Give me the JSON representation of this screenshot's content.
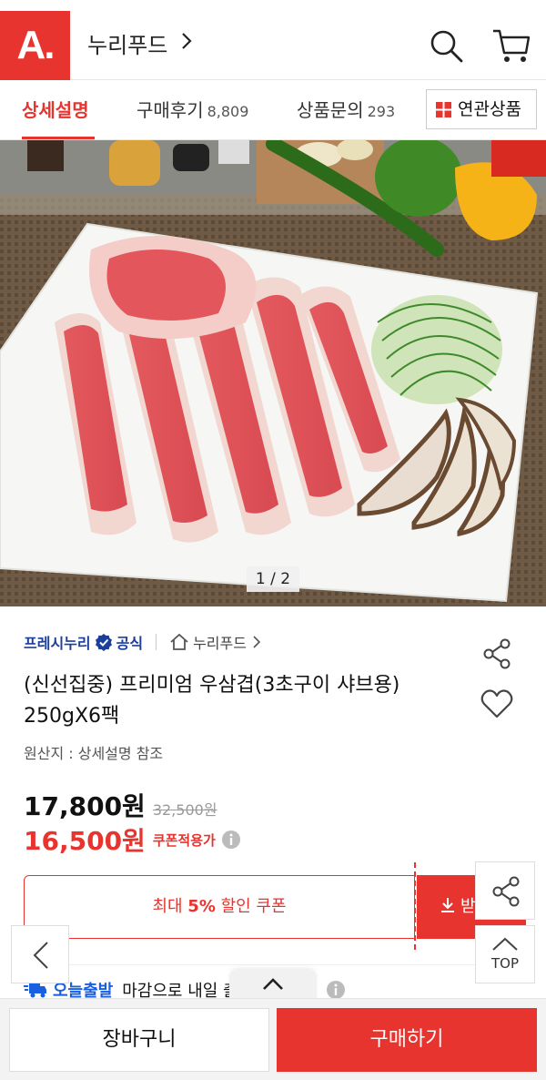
{
  "header": {
    "logo_text": "A.",
    "store_name": "누리푸드"
  },
  "tabs": [
    {
      "label": "상세설명",
      "count": ""
    },
    {
      "label": "구매후기",
      "count": "8,809"
    },
    {
      "label": "상품문의",
      "count": "293"
    }
  ],
  "related_button": {
    "label": "연관상품"
  },
  "hero": {
    "image_counter": "1 / 2",
    "description": "sliced beef brisket on white plate with shredded green onion and shiitake mushrooms"
  },
  "product": {
    "brand": "프레시누리",
    "official": "공식",
    "store_link": "누리푸드",
    "title": "(신선집중) 프리미엄 우삼겹(3초구이 샤브용) 250gX6팩",
    "origin": "원산지 : 상세설명 참조",
    "price": "17,800원",
    "original_price": "32,500원",
    "coupon_price": "16,500원",
    "coupon_price_label": "쿠폰적용가"
  },
  "coupon": {
    "prefix": "최대 ",
    "percent": "5%",
    "suffix": " 할인 쿠폰",
    "download_label": "받기"
  },
  "delivery": {
    "badge": "오늘출발",
    "text": "마감으로 내일 출발"
  },
  "floating": {
    "top_label": "TOP"
  },
  "bottom_bar": {
    "cart_label": "장바구니",
    "buy_label": "구매하기"
  },
  "colors": {
    "accent": "#e8342f",
    "brand_blue": "#1c3f9a",
    "delivery_blue": "#1a5fe0"
  }
}
